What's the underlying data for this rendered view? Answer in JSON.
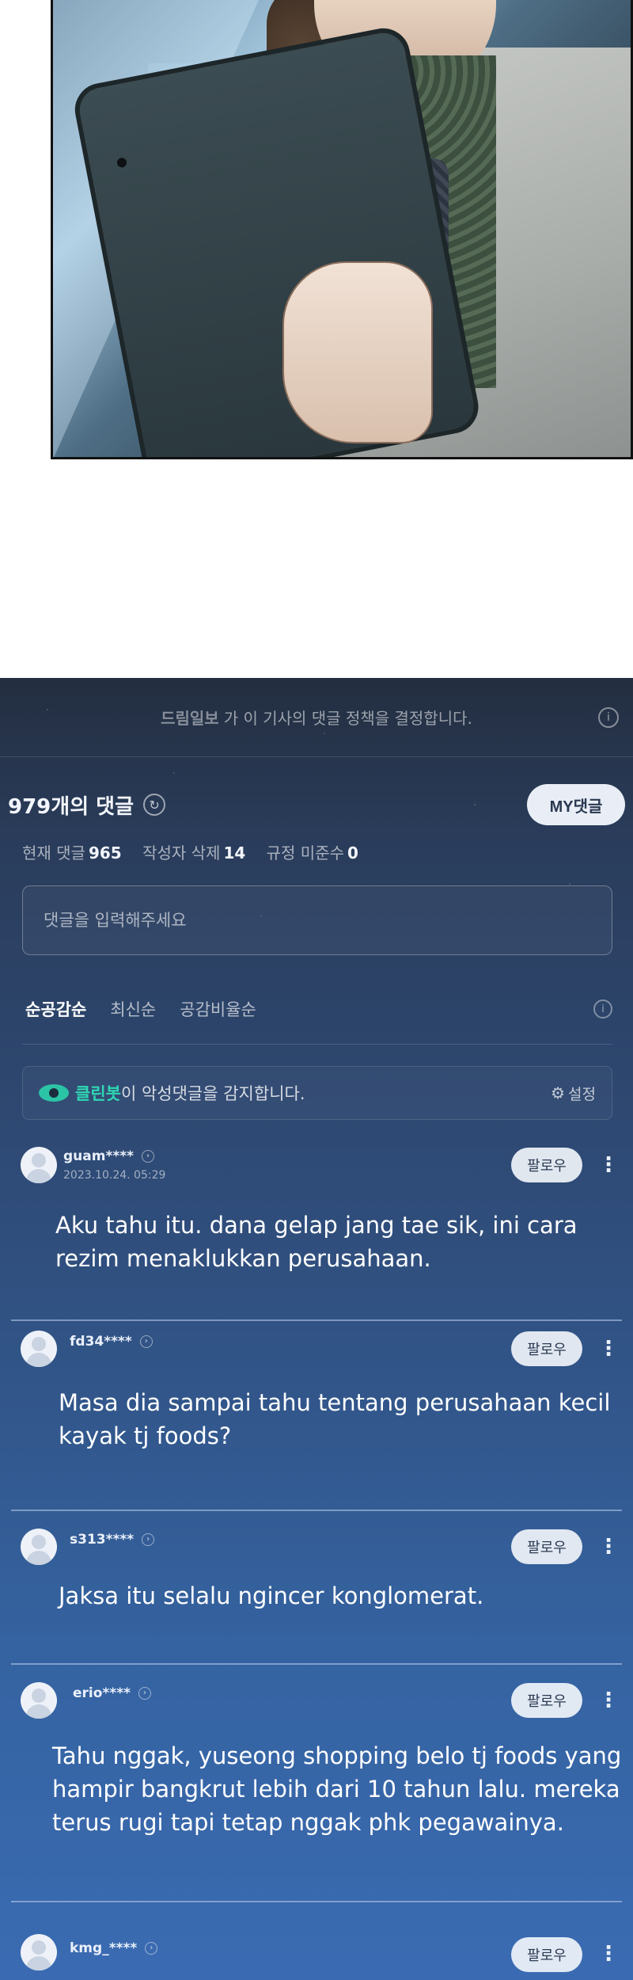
{
  "policy_banner": {
    "brand": "드림일보",
    "text": "가 이 기사의 댓글 정책을 결정합니다."
  },
  "header": {
    "count_title": "979개의 댓글",
    "my_button": "MY댓글"
  },
  "stats": {
    "current_label": "현재 댓글",
    "current_value": "965",
    "deleted_label": "작성자 삭제",
    "deleted_value": "14",
    "violation_label": "규정 미준수",
    "violation_value": "0"
  },
  "input": {
    "placeholder": "댓글을 입력해주세요"
  },
  "sort": {
    "options": [
      "순공감순",
      "최신순",
      "공감비율순"
    ]
  },
  "cleanbot": {
    "name": "클린봇",
    "text": "이 악성댓글을 감지합니다.",
    "settings_label": "설정"
  },
  "comments": [
    {
      "username": "guam****",
      "timestamp": "2023.10.24. 05:29",
      "follow_label": "팔로우",
      "body": "Aku tahu itu. dana gelap jang tae sik, ini cara rezim menaklukkan perusahaan."
    },
    {
      "username": "fd34****",
      "timestamp": "",
      "follow_label": "팔로우",
      "body": "Masa dia sampai tahu tentang perusahaan kecil kayak tj foods?"
    },
    {
      "username": "s313****",
      "timestamp": "",
      "follow_label": "팔로우",
      "body": "Jaksa itu selalu ngincer konglomerat."
    },
    {
      "username": "erio****",
      "timestamp": "",
      "follow_label": "팔로우",
      "body": "Tahu nggak, yuseong shopping belo tj foods yang hampir bangkrut lebih dari 10 tahun lalu. mereka terus rugi tapi tetap nggak phk pegawainya."
    },
    {
      "username": "kmg_****",
      "timestamp": "",
      "follow_label": "팔로우",
      "body": ""
    }
  ]
}
